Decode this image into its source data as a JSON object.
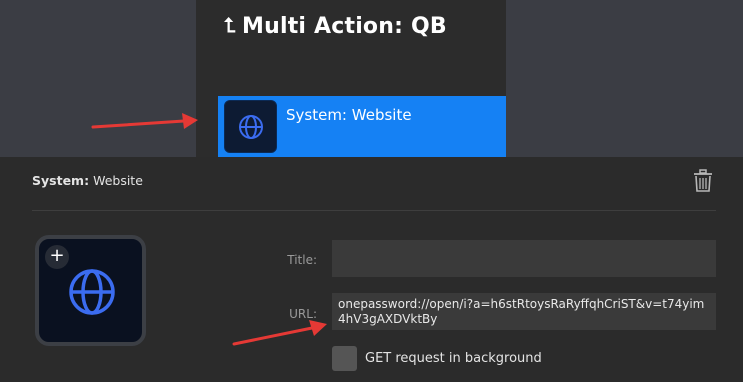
{
  "multi_action": {
    "title": "Multi Action: QB",
    "back_glyph": "⮤",
    "item": {
      "label": "System: Website",
      "icon": "globe-icon"
    }
  },
  "inspector": {
    "category": "System:",
    "action": "Website",
    "icon": "globe-icon",
    "title_label": "Title:",
    "title_value": "",
    "url_label": "URL:",
    "url_value": "onepassword://open/i?a=h6stRtoysRaRyffqhCriST&v=t74yim4hV3gAXDVktBy",
    "checkbox_label": "GET request in background",
    "checkbox_checked": false
  },
  "colors": {
    "selection_blue": "#1581f4",
    "globe_blue": "#3b6cf0",
    "arrow_red": "#e53935"
  }
}
